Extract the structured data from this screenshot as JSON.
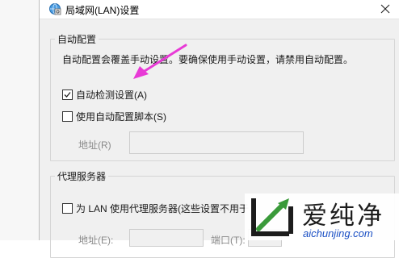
{
  "window": {
    "title": "局域网(LAN)设置"
  },
  "auto_config": {
    "legend": "自动配置",
    "description": "自动配置会覆盖手动设置。要确保使用手动设置，请禁用自动配置。",
    "auto_detect": {
      "label": "自动检测设置(A)",
      "checked": true
    },
    "use_script": {
      "label": "使用自动配置脚本(S)",
      "checked": false
    },
    "address_label": "地址(R)",
    "address_value": ""
  },
  "proxy": {
    "legend": "代理服务器",
    "use_proxy": {
      "label": "为 LAN 使用代理服务器(这些设置不用于",
      "checked": false
    },
    "address_label": "地址(E):",
    "port_label": "端口(T):"
  },
  "watermark": {
    "brand_cn": "爱纯净",
    "url": "aichunjing.com"
  },
  "colors": {
    "arrow": "#e83ad6",
    "accent": "#1a4fc4"
  }
}
